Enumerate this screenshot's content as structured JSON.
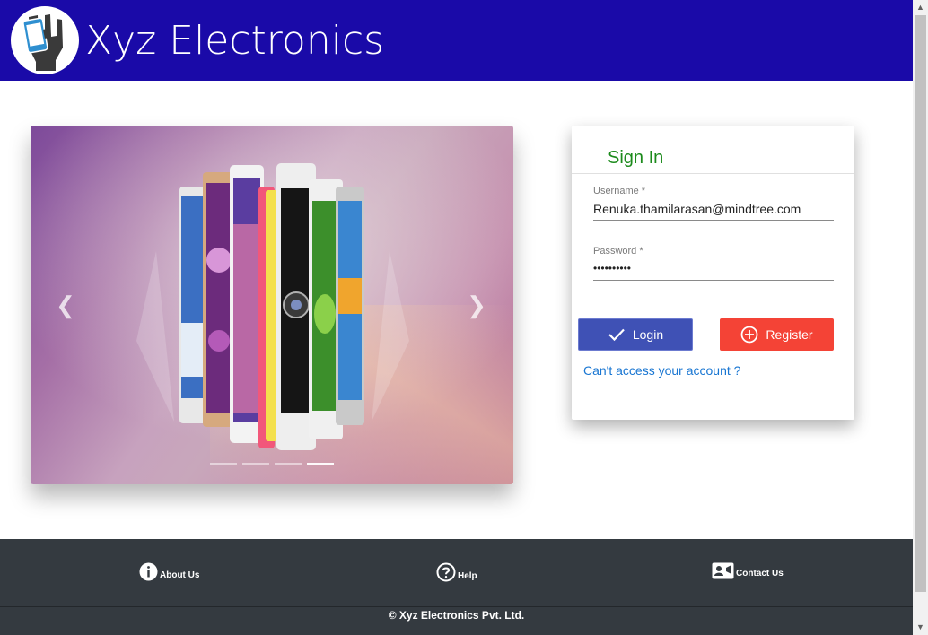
{
  "header": {
    "brand": "Xyz Electronics",
    "background": "#1a0aa8",
    "logo_icon": "hand-holding-phone-icon"
  },
  "carousel": {
    "prev_icon": "chevron-left-icon",
    "next_icon": "chevron-right-icon",
    "prev_glyph": "❮",
    "next_glyph": "❯",
    "slide_count": 4,
    "active_slide": 4
  },
  "signin": {
    "title": "Sign In",
    "title_color": "#1b8a1b",
    "username_label": "Username *",
    "username_value": "Renuka.thamilarasan@mindtree.com",
    "password_label": "Password *",
    "password_value": "••••••••••",
    "login_label": "Login",
    "login_icon": "checkmark-icon",
    "login_color": "#3f51b5",
    "register_label": "Register",
    "register_icon": "plus-circle-icon",
    "register_color": "#f44336",
    "forgot_link": "Can't access your account ?"
  },
  "footer": {
    "about_label": "About Us",
    "about_icon": "info-icon",
    "help_label": "Help",
    "help_icon": "question-circle-icon",
    "contact_label": "Contact Us",
    "contact_icon": "contact-card-icon",
    "copyright": "© Xyz Electronics Pvt. Ltd.",
    "background": "#343a40"
  }
}
